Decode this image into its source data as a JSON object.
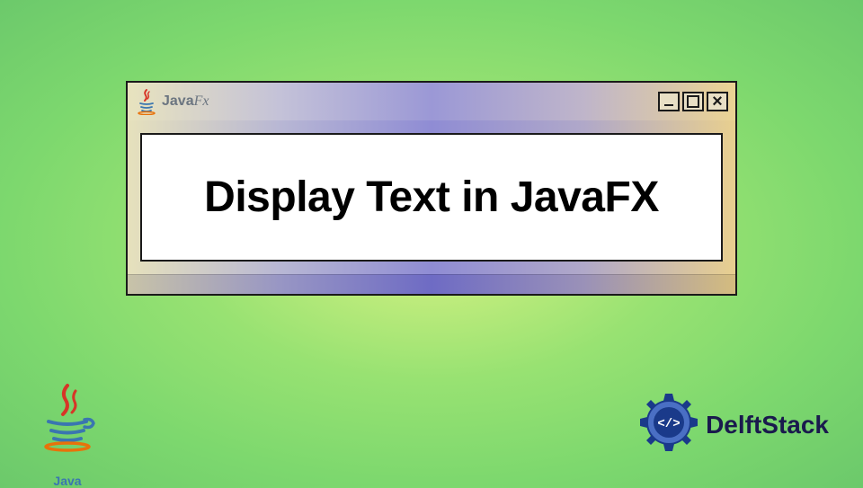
{
  "window": {
    "app_label_java": "Java",
    "app_label_fx": "Fx",
    "content_text": "Display Text in JavaFX"
  },
  "branding": {
    "java_label": "Java",
    "delftstack": "DelftStack"
  },
  "colors": {
    "java_blue": "#3a76b0",
    "java_orange": "#e8720a",
    "java_red": "#d73527",
    "delft_blue": "#1a3a8a"
  }
}
